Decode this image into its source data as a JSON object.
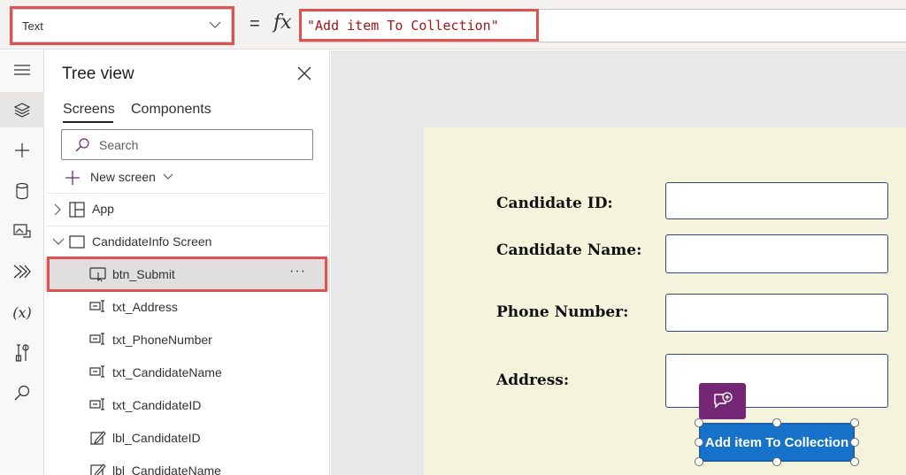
{
  "formula_bar": {
    "property": "Text",
    "equals": "=",
    "fx": "fx",
    "formula": "\"Add item To Collection\""
  },
  "rail": {
    "icons": [
      "hamburger-icon",
      "layers-icon",
      "plus-icon",
      "database-icon",
      "media-icon",
      "power-automate-icon",
      "variables-icon",
      "tools-icon",
      "search-icon"
    ],
    "variables_label": "(x)"
  },
  "tree": {
    "title": "Tree view",
    "tabs": [
      "Screens",
      "Components"
    ],
    "active_tab": "Screens",
    "search_placeholder": "Search",
    "new_screen_label": "New screen",
    "app_label": "App",
    "screen_label": "CandidateInfo Screen",
    "items": [
      {
        "label": "btn_Submit",
        "icon": "button-icon",
        "selected": true
      },
      {
        "label": "txt_Address",
        "icon": "text-input-icon"
      },
      {
        "label": "txt_PhoneNumber",
        "icon": "text-input-icon"
      },
      {
        "label": "txt_CandidateName",
        "icon": "text-input-icon"
      },
      {
        "label": "txt_CandidateID",
        "icon": "text-input-icon"
      },
      {
        "label": "lbl_CandidateID",
        "icon": "label-icon"
      },
      {
        "label": "lbl_CandidateName",
        "icon": "label-icon"
      }
    ],
    "more": "···"
  },
  "canvas": {
    "fields": [
      {
        "label": "Candidate ID:"
      },
      {
        "label": "Candidate Name:"
      },
      {
        "label": "Phone Number:"
      },
      {
        "label": "Address:"
      }
    ],
    "button_label": "Add item To Collection"
  },
  "colors": {
    "highlight": "#e05252",
    "screen_bg": "#f4f3dc",
    "button": "#1773c9",
    "comment": "#742774",
    "formula_string": "#a31515"
  }
}
